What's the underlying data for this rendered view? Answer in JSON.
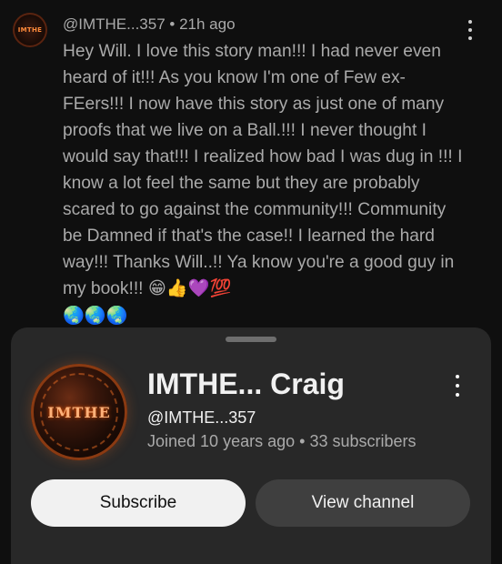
{
  "comment": {
    "author": "@IMTHE...357",
    "separator": " • ",
    "time": "21h ago",
    "avatar_text": "IMTHE",
    "text": "Hey Will. I love this story man!!! I had never even heard of it!!! As you know I'm one of Few ex-FEers!!! I now have this story as just one of many proofs that we live on a Ball.!!! I never thought I would say that!!! I realized how bad I was dug in !!! I know a lot feel the same but they are probably scared to go against the community!!! Community be Damned if that's the case!! I learned the hard way!!! Thanks Will..!! Ya know you're a good guy in my book!!! 😁👍💜💯",
    "emoji_line": "🌏🌏🌏",
    "more_icon": "more-vertical-icon"
  },
  "sheet": {
    "avatar_text": "IMTHE",
    "channel_name": "IMTHE... Craig",
    "handle": "@IMTHE...357",
    "joined": "Joined 10 years ago",
    "stats_separator": " • ",
    "subscribers": "33 subscribers",
    "subscribe_label": "Subscribe",
    "view_channel_label": "View channel",
    "more_icon": "more-vertical-icon"
  },
  "colors": {
    "background": "#0f0f0f",
    "sheet": "#282828",
    "subscribe_bg": "#f1f1f1",
    "view_channel_bg": "#3f3f3f",
    "secondary_text": "#aaaaaa"
  }
}
